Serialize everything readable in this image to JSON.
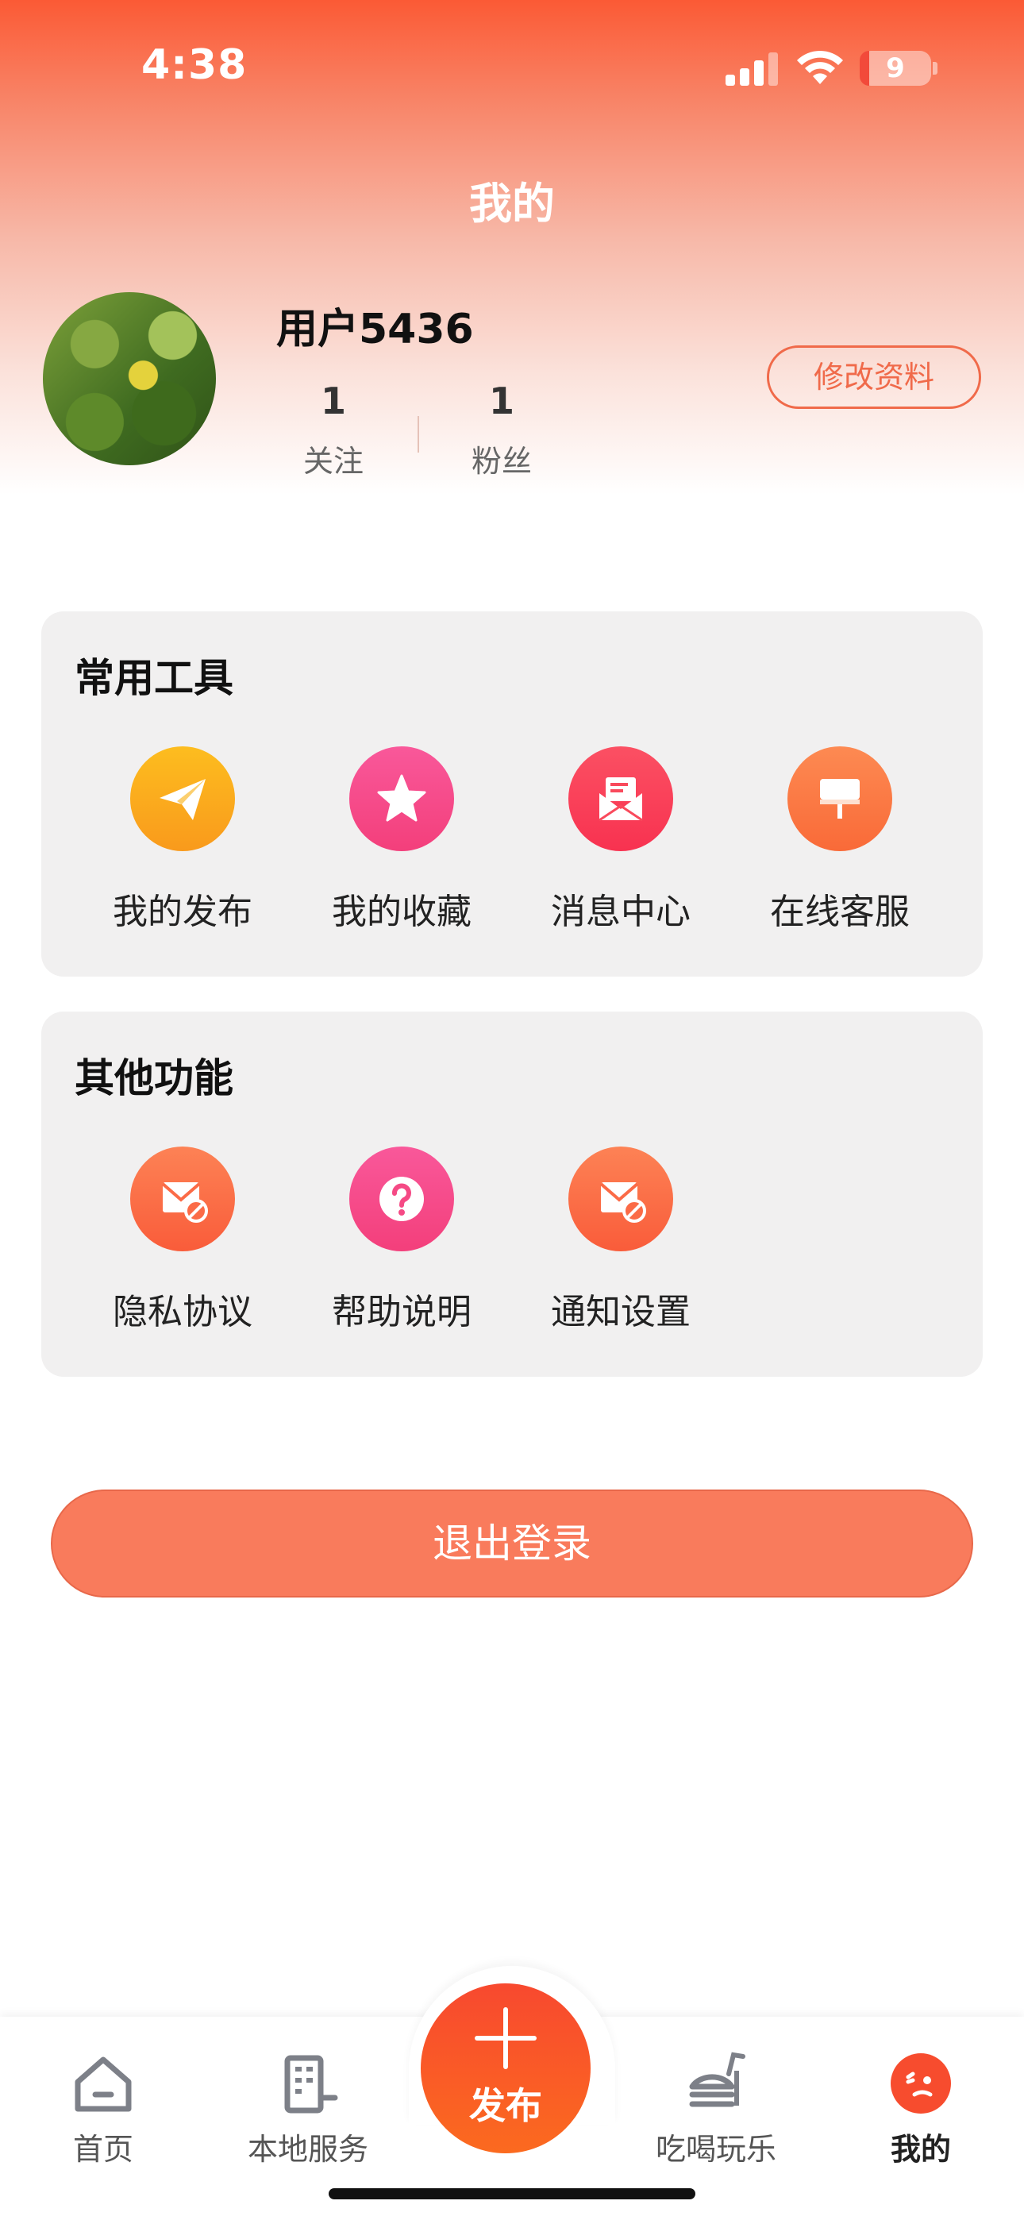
{
  "status_bar": {
    "time": "4:38",
    "battery": "9"
  },
  "header": {
    "title": "我的"
  },
  "profile": {
    "username": "用户5436",
    "stats": [
      {
        "value": "1",
        "label": "关注"
      },
      {
        "value": "1",
        "label": "粉丝"
      }
    ],
    "edit_label": "修改资料"
  },
  "tools": {
    "title": "常用工具",
    "items": [
      {
        "label": "我的发布",
        "icon": "paper-plane-icon",
        "color": "#fba81c"
      },
      {
        "label": "我的收藏",
        "icon": "star-icon",
        "color": "#f64b86"
      },
      {
        "label": "消息中心",
        "icon": "mail-icon",
        "color": "#f93f56"
      },
      {
        "label": "在线客服",
        "icon": "customer-service-icon",
        "color": "#fb7a45"
      }
    ]
  },
  "other": {
    "title": "其他功能",
    "items": [
      {
        "label": "隐私协议",
        "icon": "privacy-mail-icon",
        "color": "#fb7045"
      },
      {
        "label": "帮助说明",
        "icon": "help-icon",
        "color": "#f64b86"
      },
      {
        "label": "通知设置",
        "icon": "notification-mail-icon",
        "color": "#fb7045"
      }
    ]
  },
  "logout_label": "退出登录",
  "tabbar": {
    "tabs": [
      {
        "label": "首页",
        "icon": "home-icon"
      },
      {
        "label": "本地服务",
        "icon": "building-icon"
      },
      {
        "label": "发布",
        "icon": "plus-icon"
      },
      {
        "label": "吃喝玩乐",
        "icon": "food-icon"
      },
      {
        "label": "我的",
        "icon": "profile-icon"
      }
    ],
    "active": "我的"
  }
}
